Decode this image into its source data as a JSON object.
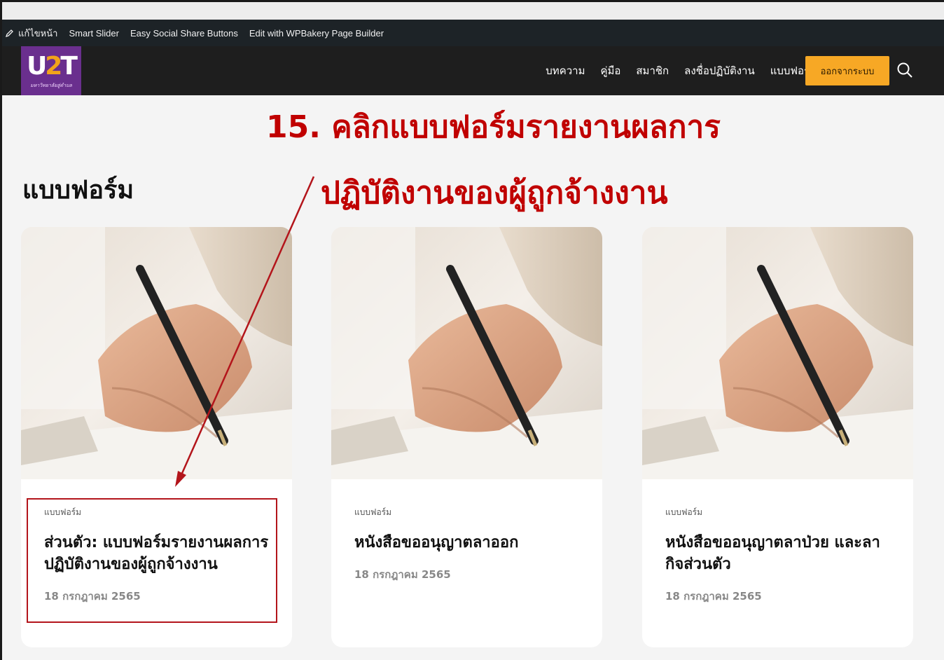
{
  "admin_bar": {
    "edit_page": "แก้ไขหน้า",
    "smart_slider": "Smart Slider",
    "easy_social": "Easy Social Share Buttons",
    "wpbakery": "Edit with WPBakery Page Builder"
  },
  "logo": {
    "mark_u": "U",
    "mark_2": "2",
    "mark_t": "T",
    "subtitle": "มหาวิทยาลัยสู่ตำบล"
  },
  "nav": {
    "items": [
      "บทความ",
      "คู่มือ",
      "สมาชิก",
      "ลงชื่อปฏิบัติงาน",
      "แบบฟอร์ม"
    ],
    "logout": "ออกจากระบบ"
  },
  "page": {
    "heading": "แบบฟอร์ม"
  },
  "annotation": {
    "line1": "15. คลิกแบบฟอร์มรายงานผลการ",
    "line2": "ปฏิบัติงานของผู้ถูกจ้างงาน"
  },
  "cards": [
    {
      "category": "แบบฟอร์ม",
      "title": "ส่วนตัว: แบบฟอร์มรายงานผลการปฏิบัติงานของผู้ถูกจ้างงาน",
      "date": "18 กรกฎาคม 2565"
    },
    {
      "category": "แบบฟอร์ม",
      "title": "หนังสือขออนุญาตลาออก",
      "date": "18 กรกฎาคม 2565"
    },
    {
      "category": "แบบฟอร์ม",
      "title": "หนังสือขออนุญาตลาป่วย และลากิจส่วนตัว",
      "date": "18 กรกฎาคม 2565"
    }
  ],
  "colors": {
    "admin_bg": "#1d2327",
    "header_bg": "#1e1e1e",
    "logo_bg": "#6a2f8e",
    "button_accent": "#f7a825",
    "annotation_red": "#c00000"
  }
}
